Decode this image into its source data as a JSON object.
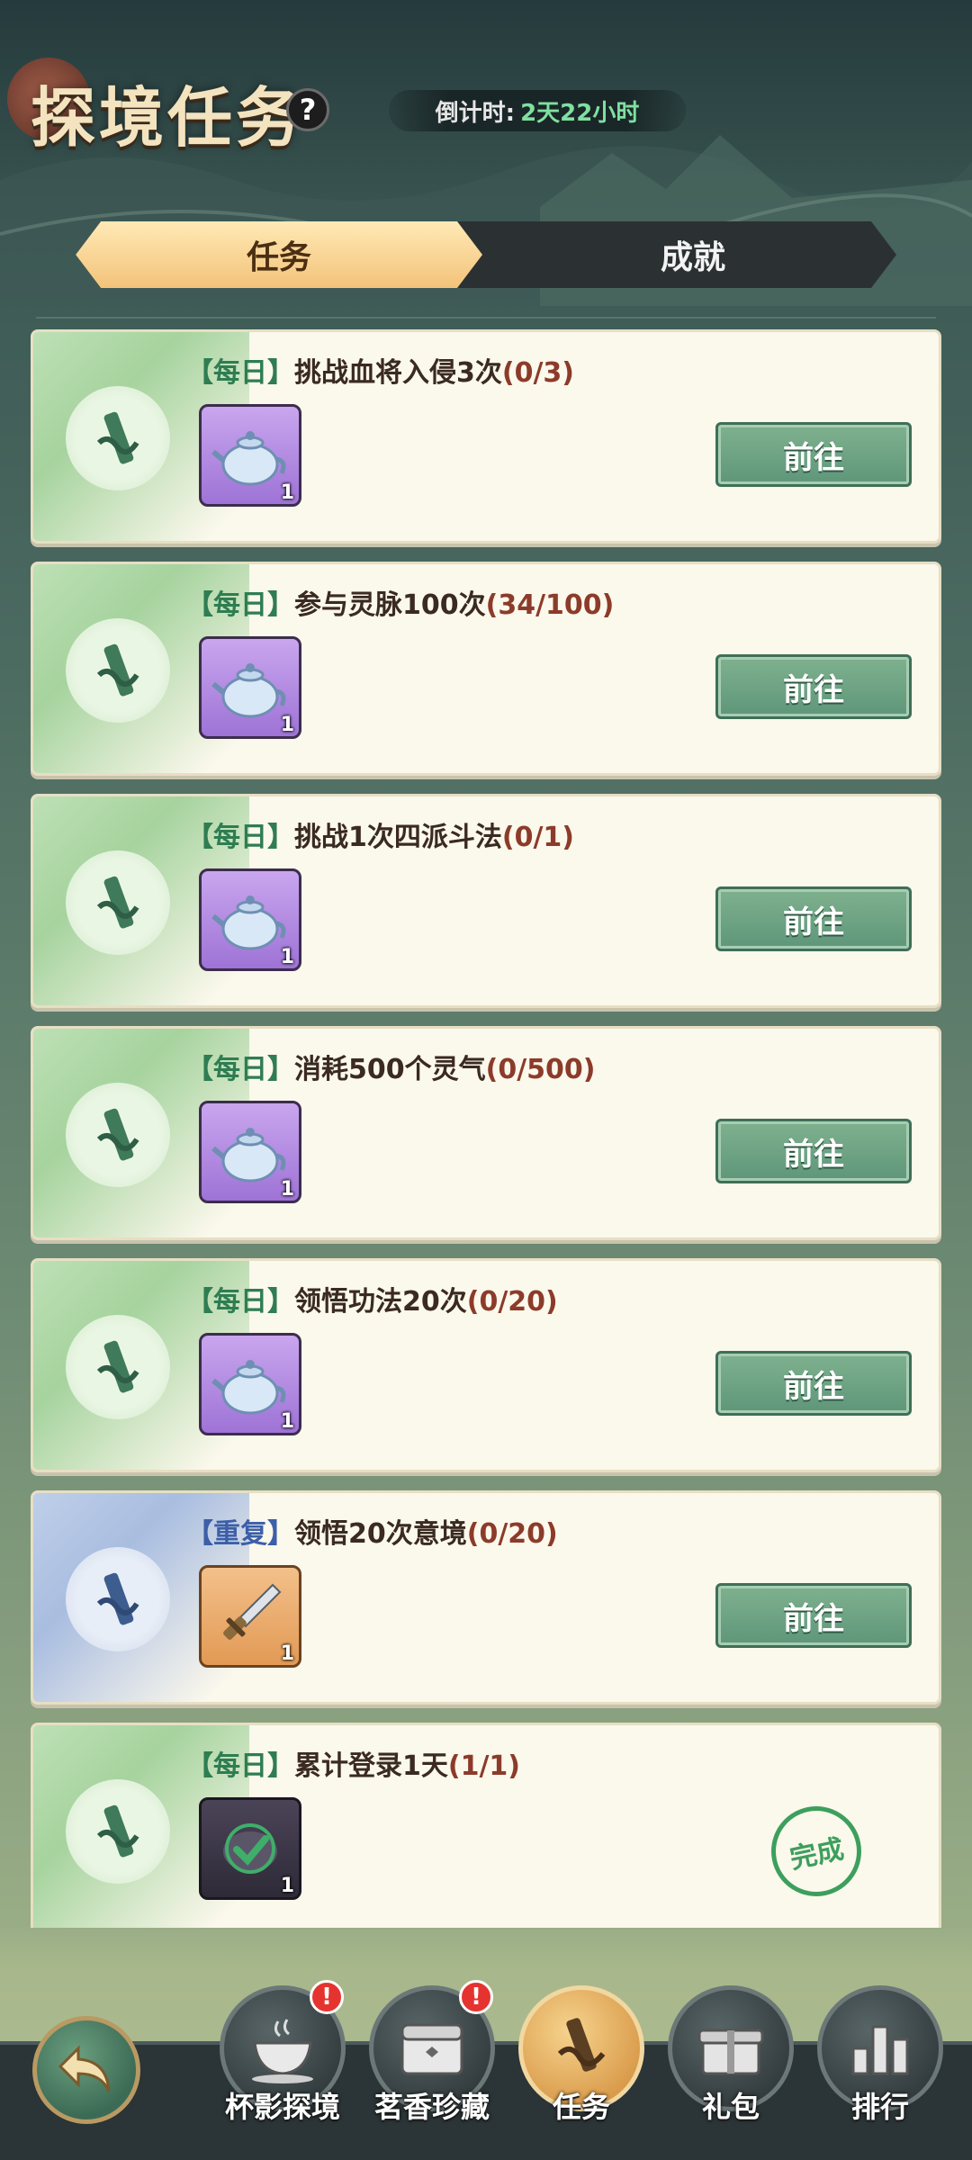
{
  "header": {
    "title": "探境任务",
    "help_label": "?",
    "countdown_label": "倒计时:",
    "countdown_value": "2天22小时"
  },
  "tabs": [
    {
      "label": "任务",
      "active": true
    },
    {
      "label": "成就",
      "active": false
    }
  ],
  "tasks": [
    {
      "tag": "【每日】",
      "name": "挑战血将入侵3次",
      "progress": "(0/3)",
      "reward_icon": "teapot-icon",
      "reward_count": "1",
      "action": "前往",
      "theme": "green"
    },
    {
      "tag": "【每日】",
      "name": "参与灵脉100次",
      "progress": "(34/100)",
      "reward_icon": "teapot-icon",
      "reward_count": "1",
      "action": "前往",
      "theme": "green"
    },
    {
      "tag": "【每日】",
      "name": "挑战1次四派斗法",
      "progress": "(0/1)",
      "reward_icon": "teapot-icon",
      "reward_count": "1",
      "action": "前往",
      "theme": "green"
    },
    {
      "tag": "【每日】",
      "name": "消耗500个灵气",
      "progress": "(0/500)",
      "reward_icon": "teapot-icon",
      "reward_count": "1",
      "action": "前往",
      "theme": "green"
    },
    {
      "tag": "【每日】",
      "name": "领悟功法20次",
      "progress": "(0/20)",
      "reward_icon": "teapot-icon",
      "reward_count": "1",
      "action": "前往",
      "theme": "green"
    },
    {
      "tag": "【重复】",
      "name": "领悟20次意境",
      "progress": "(0/20)",
      "reward_icon": "dagger-icon",
      "reward_count": "1",
      "action": "前往",
      "theme": "blue"
    },
    {
      "tag": "【每日】",
      "name": "累计登录1天",
      "progress": "(1/1)",
      "reward_icon": "claimed-check-icon",
      "reward_count": "1",
      "action": "完成",
      "theme": "green"
    }
  ],
  "bottom_nav": [
    {
      "label": "杯影探境",
      "icon": "teacup-icon",
      "alert": "!"
    },
    {
      "label": "茗香珍藏",
      "icon": "chest-icon",
      "alert": "!"
    },
    {
      "label": "任务",
      "icon": "scroll-icon",
      "alert": ""
    },
    {
      "label": "礼包",
      "icon": "gift-box-icon",
      "alert": ""
    },
    {
      "label": "排行",
      "icon": "ranking-icon",
      "alert": ""
    }
  ],
  "colors": {
    "accent_green": "#5e967a",
    "tab_active": "#f3c37a",
    "progress_red": "#8c3b2a",
    "countdown_green": "#7fe0a0",
    "alert_red": "#e5342f"
  }
}
